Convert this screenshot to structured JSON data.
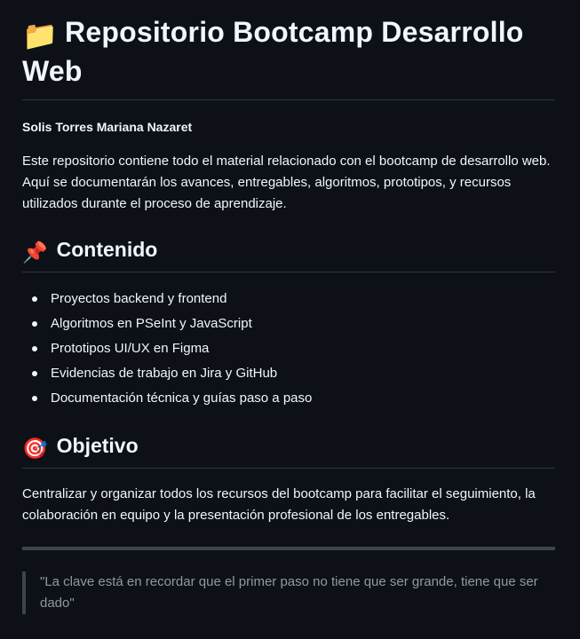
{
  "title": {
    "emoji": "📁",
    "icon": "folder-icon",
    "text": "Repositorio Bootcamp Desarrollo Web"
  },
  "author": "Solis Torres Mariana Nazaret",
  "intro": "Este repositorio contiene todo el material relacionado con el bootcamp de desarrollo web. Aquí se documentarán los avances, entregables, algoritmos, prototipos, y recursos utilizados durante el proceso de aprendizaje.",
  "contenido": {
    "emoji": "📌",
    "icon": "pushpin-icon",
    "heading": "Contenido",
    "items": [
      "Proyectos backend y frontend",
      "Algoritmos en PSeInt y JavaScript",
      "Prototipos UI/UX en Figma",
      "Evidencias de trabajo en Jira y GitHub",
      "Documentación técnica y guías paso a paso"
    ]
  },
  "objetivo": {
    "emoji": "🎯",
    "icon": "target-icon",
    "heading": "Objetivo",
    "text": "Centralizar y organizar todos los recursos del bootcamp para facilitar el seguimiento, la colaboración en equipo y la presentación profesional de los entregables."
  },
  "quote": "\"La clave está en recordar que el primer paso no tiene que ser grande, tiene que ser dado\"",
  "colors": {
    "background": "#0d1117",
    "text": "#f0f6fc",
    "muted": "#9198a1",
    "border": "#30363d"
  }
}
